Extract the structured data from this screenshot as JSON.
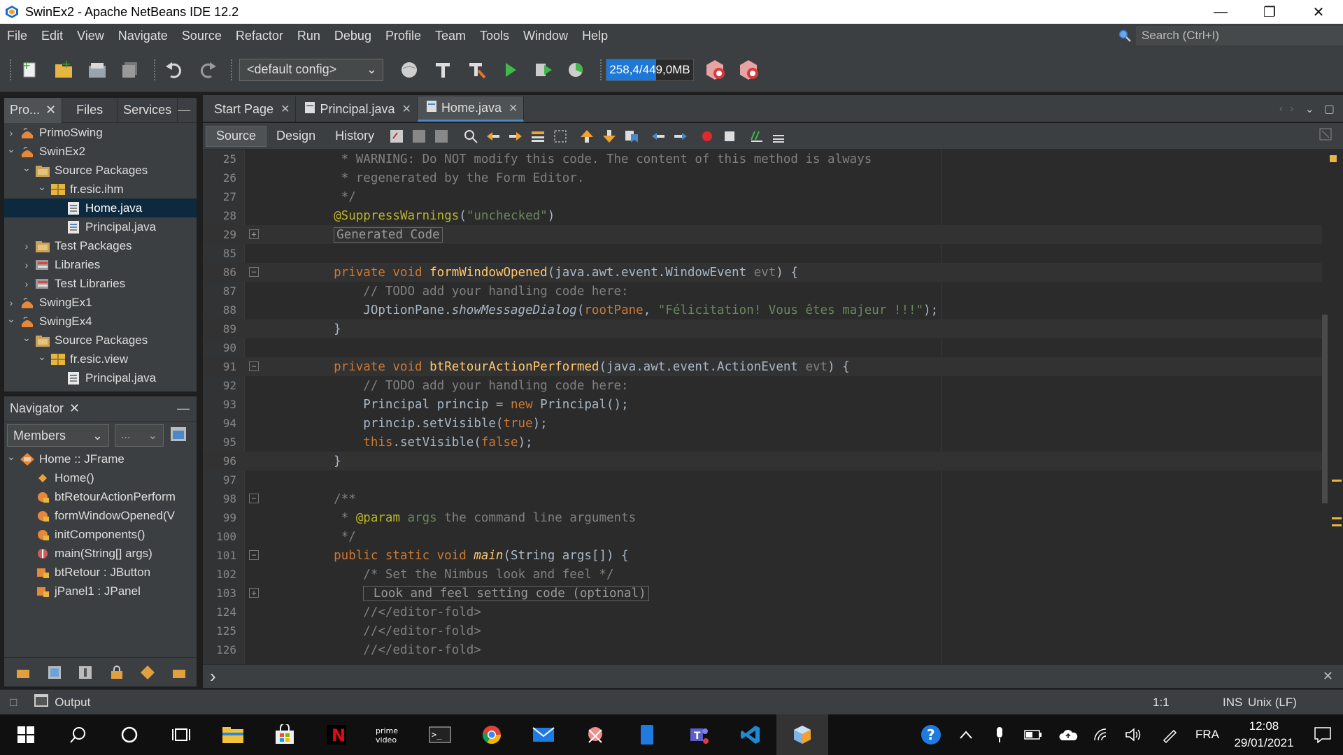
{
  "window": {
    "title": "SwinEx2 - Apache NetBeans IDE 12.2"
  },
  "menu": [
    "File",
    "Edit",
    "View",
    "Navigate",
    "Source",
    "Refactor",
    "Run",
    "Debug",
    "Profile",
    "Team",
    "Tools",
    "Window",
    "Help"
  ],
  "search": {
    "placeholder": "Search (Ctrl+I)"
  },
  "toolbar": {
    "config": "<default config>",
    "memory": "258,4/449,0MB",
    "memory_fraction": 0.576
  },
  "projects_panel": {
    "tabs": [
      "Pro...",
      "Files",
      "Services"
    ],
    "tree": [
      {
        "label": "PrimoSwing",
        "level": 0,
        "arrow": "›",
        "icon": "project"
      },
      {
        "label": "SwinEx2",
        "level": 0,
        "arrow": "⌄",
        "icon": "project"
      },
      {
        "label": "Source Packages",
        "level": 1,
        "arrow": "⌄",
        "icon": "folder"
      },
      {
        "label": "fr.esic.ihm",
        "level": 2,
        "arrow": "⌄",
        "icon": "package"
      },
      {
        "label": "Home.java",
        "level": 3,
        "arrow": "",
        "icon": "file",
        "selected": true
      },
      {
        "label": "Principal.java",
        "level": 3,
        "arrow": "",
        "icon": "file"
      },
      {
        "label": "Test Packages",
        "level": 1,
        "arrow": "›",
        "icon": "folder"
      },
      {
        "label": "Libraries",
        "level": 1,
        "arrow": "›",
        "icon": "lib"
      },
      {
        "label": "Test Libraries",
        "level": 1,
        "arrow": "›",
        "icon": "lib"
      },
      {
        "label": "SwingEx1",
        "level": 0,
        "arrow": "›",
        "icon": "project"
      },
      {
        "label": "SwingEx4",
        "level": 0,
        "arrow": "⌄",
        "icon": "project"
      },
      {
        "label": "Source Packages",
        "level": 1,
        "arrow": "⌄",
        "icon": "folder"
      },
      {
        "label": "fr.esic.view",
        "level": 2,
        "arrow": "⌄",
        "icon": "package"
      },
      {
        "label": "Principal.java",
        "level": 3,
        "arrow": "",
        "icon": "file"
      }
    ]
  },
  "navigator": {
    "title": "Navigator",
    "filter": "Members",
    "filter2": "...",
    "items": [
      {
        "label": "Home :: JFrame",
        "level": 0,
        "arrow": "⌄",
        "icon": "class"
      },
      {
        "label": "Home()",
        "level": 1,
        "icon": "ctor"
      },
      {
        "label": "btRetourActionPerform",
        "level": 1,
        "icon": "method"
      },
      {
        "label": "formWindowOpened(V",
        "level": 1,
        "icon": "method"
      },
      {
        "label": "initComponents()",
        "level": 1,
        "icon": "method"
      },
      {
        "label": "main(String[] args)",
        "level": 1,
        "icon": "static"
      },
      {
        "label": "btRetour : JButton",
        "level": 1,
        "icon": "field"
      },
      {
        "label": "jPanel1 : JPanel",
        "level": 1,
        "icon": "field"
      }
    ]
  },
  "editor": {
    "tabs": [
      {
        "label": "Start Page",
        "active": false
      },
      {
        "label": "Principal.java",
        "active": false
      },
      {
        "label": "Home.java",
        "active": true
      }
    ],
    "views": [
      "Source",
      "Design",
      "History"
    ],
    "lines": [
      {
        "n": "25",
        "fold": "",
        "segs": [
          [
            "c-cm",
            "     * WARNING: Do NOT modify this code. The content of this method is always"
          ]
        ]
      },
      {
        "n": "26",
        "fold": "",
        "segs": [
          [
            "c-cm",
            "     * regenerated by the Form Editor."
          ]
        ]
      },
      {
        "n": "27",
        "fold": "",
        "segs": [
          [
            "c-cm",
            "     */"
          ]
        ]
      },
      {
        "n": "28",
        "fold": "",
        "segs": [
          [
            "c-an",
            "    @SuppressWarnings"
          ],
          [
            "",
            "("
          ],
          [
            "c-str",
            "\"unchecked\""
          ],
          [
            "",
            ")"
          ]
        ]
      },
      {
        "n": "29",
        "fold": "+",
        "cur": true,
        "segs": [
          [
            "",
            "    "
          ],
          [
            "fbox",
            "Generated Code"
          ]
        ]
      },
      {
        "n": "85",
        "fold": "",
        "segs": []
      },
      {
        "n": "86",
        "fold": "-",
        "cur": true,
        "segs": [
          [
            "c-kw",
            "    private void "
          ],
          [
            "c-fn",
            "formWindowOpened"
          ],
          [
            "",
            "(java.awt.event.WindowEvent "
          ],
          [
            "c-cm",
            "evt"
          ],
          [
            "",
            ") {"
          ]
        ]
      },
      {
        "n": "87",
        "fold": "",
        "segs": [
          [
            "c-cm",
            "        // TODO add your handling code here:"
          ]
        ]
      },
      {
        "n": "88",
        "fold": "",
        "segs": [
          [
            "",
            "        JOptionPane."
          ],
          [
            "c-it",
            "showMessageDialog"
          ],
          [
            "",
            "("
          ],
          [
            "c-kw",
            "rootPane"
          ],
          [
            "",
            ", "
          ],
          [
            "c-str",
            "\"Félicitation! Vous êtes majeur !!!\""
          ],
          [
            "",
            ");"
          ]
        ]
      },
      {
        "n": "89",
        "fold": "",
        "cur": true,
        "segs": [
          [
            "",
            "    }"
          ]
        ]
      },
      {
        "n": "90",
        "fold": "",
        "segs": []
      },
      {
        "n": "91",
        "fold": "-",
        "cur": true,
        "segs": [
          [
            "c-kw",
            "    private void "
          ],
          [
            "c-fn",
            "btRetourActionPerformed"
          ],
          [
            "",
            "(java.awt.event.ActionEvent "
          ],
          [
            "c-cm",
            "evt"
          ],
          [
            "",
            ") {"
          ]
        ]
      },
      {
        "n": "92",
        "fold": "",
        "segs": [
          [
            "c-cm",
            "        // TODO add your handling code here:"
          ]
        ]
      },
      {
        "n": "93",
        "fold": "",
        "segs": [
          [
            "",
            "        Principal princip = "
          ],
          [
            "c-kw",
            "new "
          ],
          [
            "",
            "Principal();"
          ]
        ]
      },
      {
        "n": "94",
        "fold": "",
        "segs": [
          [
            "",
            "        princip.setVisible("
          ],
          [
            "c-kw",
            "true"
          ],
          [
            "",
            ");"
          ]
        ]
      },
      {
        "n": "95",
        "fold": "",
        "segs": [
          [
            "c-kw",
            "        this"
          ],
          [
            "",
            ".setVisible("
          ],
          [
            "c-kw",
            "false"
          ],
          [
            "",
            ");"
          ]
        ]
      },
      {
        "n": "96",
        "fold": "",
        "cur": true,
        "segs": [
          [
            "",
            "    }"
          ]
        ]
      },
      {
        "n": "97",
        "fold": "",
        "segs": []
      },
      {
        "n": "98",
        "fold": "-",
        "segs": [
          [
            "c-cm",
            "    /**"
          ]
        ]
      },
      {
        "n": "99",
        "fold": "",
        "segs": [
          [
            "c-cm",
            "     * "
          ],
          [
            "c-an",
            "@param "
          ],
          [
            "c-str",
            "args "
          ],
          [
            "c-cm",
            "the command line arguments"
          ]
        ]
      },
      {
        "n": "100",
        "fold": "",
        "segs": [
          [
            "c-cm",
            "     */"
          ]
        ]
      },
      {
        "n": "101",
        "fold": "-",
        "segs": [
          [
            "c-kw",
            "    public static void "
          ],
          [
            "c-fn c-it",
            "main"
          ],
          [
            "",
            "(String args[]) {"
          ]
        ]
      },
      {
        "n": "102",
        "fold": "",
        "segs": [
          [
            "c-cm",
            "        /* Set the Nimbus look and feel */"
          ]
        ]
      },
      {
        "n": "103",
        "fold": "+",
        "segs": [
          [
            "",
            "        "
          ],
          [
            "fbox",
            " Look and feel setting code (optional)"
          ]
        ]
      },
      {
        "n": "124",
        "fold": "",
        "segs": [
          [
            "c-cm",
            "        //</editor-fold>"
          ]
        ]
      },
      {
        "n": "125",
        "fold": "",
        "segs": [
          [
            "c-cm",
            "        //</editor-fold>"
          ]
        ]
      },
      {
        "n": "126",
        "fold": "",
        "segs": [
          [
            "c-cm",
            "        //</editor-fold>"
          ]
        ]
      }
    ]
  },
  "status": {
    "output": "Output",
    "position": "1:1",
    "mode": "INS",
    "eol": "Unix (LF)"
  },
  "taskbar": {
    "lang": "FRA",
    "time": "12:08",
    "date": "29/01/2021"
  }
}
